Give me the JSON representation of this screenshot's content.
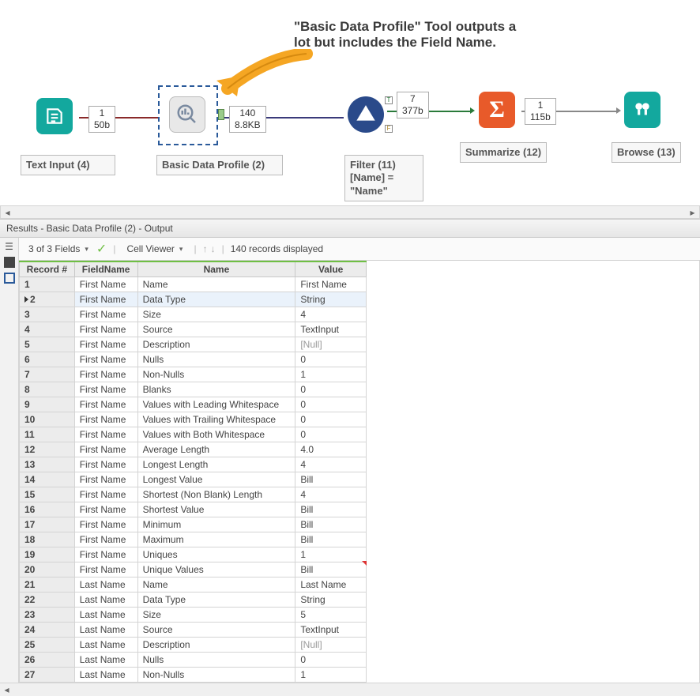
{
  "callout": {
    "line1": "\"Basic Data Profile\" Tool outputs a",
    "line2": "lot but includes the Field Name."
  },
  "tools": {
    "text_input": {
      "label": "Text Input (4)",
      "meta_top": "1",
      "meta_bottom": "50b"
    },
    "basic_profile": {
      "label": "Basic Data Profile (2)",
      "meta_top": "140",
      "meta_bottom": "8.8KB"
    },
    "filter": {
      "label": "Filter (11)",
      "expr_line1": "[Name] =",
      "expr_line2": "\"Name\"",
      "meta_top": "7",
      "meta_bottom": "377b"
    },
    "summarize": {
      "label": "Summarize (12)",
      "meta_top": "1",
      "meta_bottom": "115b"
    },
    "browse": {
      "label": "Browse (13)"
    }
  },
  "results_title": "Results - Basic Data Profile (2) - Output",
  "toolbar": {
    "fields": "3 of 3 Fields",
    "cell_viewer": "Cell Viewer",
    "records": "140 records displayed"
  },
  "columns": [
    "Record #",
    "FieldName",
    "Name",
    "Value"
  ],
  "rows": [
    {
      "n": "1",
      "f": "First Name",
      "name": "Name",
      "v": "First Name"
    },
    {
      "n": "2",
      "f": "First Name",
      "name": "Data Type",
      "v": "String"
    },
    {
      "n": "3",
      "f": "First Name",
      "name": "Size",
      "v": "4"
    },
    {
      "n": "4",
      "f": "First Name",
      "name": "Source",
      "v": "TextInput"
    },
    {
      "n": "5",
      "f": "First Name",
      "name": "Description",
      "v": "[Null]",
      "null": true
    },
    {
      "n": "6",
      "f": "First Name",
      "name": "Nulls",
      "v": "0"
    },
    {
      "n": "7",
      "f": "First Name",
      "name": "Non-Nulls",
      "v": "1"
    },
    {
      "n": "8",
      "f": "First Name",
      "name": "Blanks",
      "v": "0"
    },
    {
      "n": "9",
      "f": "First Name",
      "name": "Values with Leading Whitespace",
      "v": "0"
    },
    {
      "n": "10",
      "f": "First Name",
      "name": "Values with Trailing Whitespace",
      "v": "0"
    },
    {
      "n": "11",
      "f": "First Name",
      "name": "Values with Both Whitespace",
      "v": "0"
    },
    {
      "n": "12",
      "f": "First Name",
      "name": "Average Length",
      "v": "4.0"
    },
    {
      "n": "13",
      "f": "First Name",
      "name": "Longest Length",
      "v": "4"
    },
    {
      "n": "14",
      "f": "First Name",
      "name": "Longest Value",
      "v": "Bill"
    },
    {
      "n": "15",
      "f": "First Name",
      "name": "Shortest (Non Blank) Length",
      "v": "4"
    },
    {
      "n": "16",
      "f": "First Name",
      "name": "Shortest Value",
      "v": "Bill"
    },
    {
      "n": "17",
      "f": "First Name",
      "name": "Minimum",
      "v": "Bill"
    },
    {
      "n": "18",
      "f": "First Name",
      "name": "Maximum",
      "v": "Bill"
    },
    {
      "n": "19",
      "f": "First Name",
      "name": "Uniques",
      "v": "1"
    },
    {
      "n": "20",
      "f": "First Name",
      "name": "Unique Values",
      "v": "Bill"
    },
    {
      "n": "21",
      "f": "Last Name",
      "name": "Name",
      "v": "Last Name"
    },
    {
      "n": "22",
      "f": "Last Name",
      "name": "Data Type",
      "v": "String"
    },
    {
      "n": "23",
      "f": "Last Name",
      "name": "Size",
      "v": "5"
    },
    {
      "n": "24",
      "f": "Last Name",
      "name": "Source",
      "v": "TextInput"
    },
    {
      "n": "25",
      "f": "Last Name",
      "name": "Description",
      "v": "[Null]",
      "null": true
    },
    {
      "n": "26",
      "f": "Last Name",
      "name": "Nulls",
      "v": "0"
    },
    {
      "n": "27",
      "f": "Last Name",
      "name": "Non-Nulls",
      "v": "1"
    }
  ]
}
